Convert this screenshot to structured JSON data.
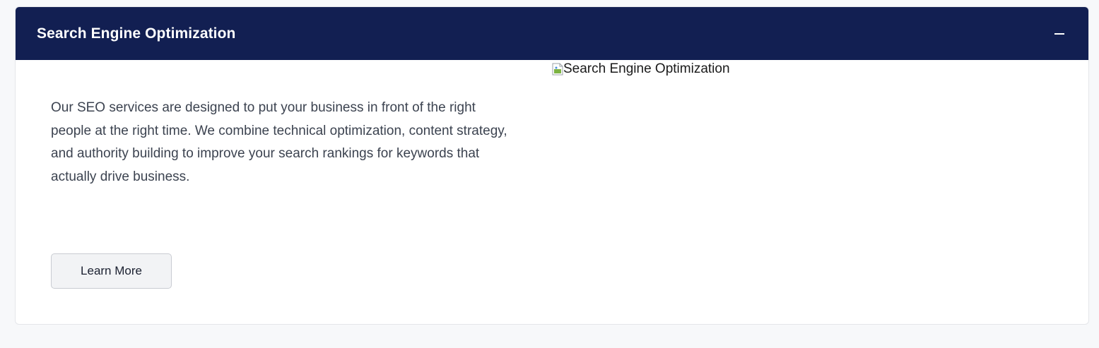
{
  "accordion": {
    "title": "Search Engine Optimization",
    "collapse_icon": "minus-icon",
    "description": "Our SEO services are designed to put your business in front of the right people at the right time. We combine technical optimization, content strategy, and authority building to improve your search rankings for keywords that actually drive business.",
    "button_label": "Learn More",
    "image_alt": "Search Engine Optimization",
    "image_icon": "broken-image-icon"
  },
  "colors": {
    "header_background": "#121f52",
    "header_text": "#ffffff",
    "body_text": "#3c4350",
    "page_background": "#f7f8fa",
    "button_background": "#f2f3f5"
  }
}
